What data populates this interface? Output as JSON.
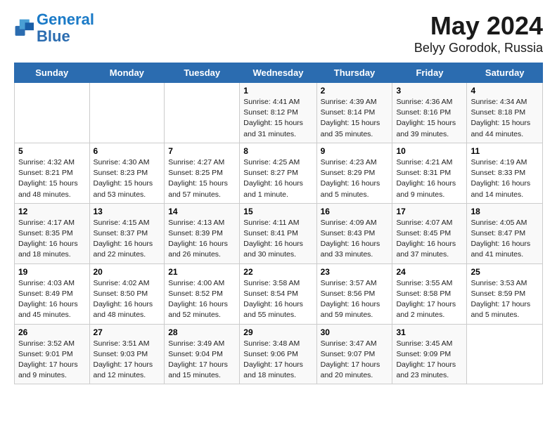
{
  "logo": {
    "line1": "General",
    "line2": "Blue"
  },
  "title": "May 2024",
  "subtitle": "Belyy Gorodok, Russia",
  "days_of_week": [
    "Sunday",
    "Monday",
    "Tuesday",
    "Wednesday",
    "Thursday",
    "Friday",
    "Saturday"
  ],
  "weeks": [
    [
      {
        "day": "",
        "info": ""
      },
      {
        "day": "",
        "info": ""
      },
      {
        "day": "",
        "info": ""
      },
      {
        "day": "1",
        "info": "Sunrise: 4:41 AM\nSunset: 8:12 PM\nDaylight: 15 hours and 31 minutes."
      },
      {
        "day": "2",
        "info": "Sunrise: 4:39 AM\nSunset: 8:14 PM\nDaylight: 15 hours and 35 minutes."
      },
      {
        "day": "3",
        "info": "Sunrise: 4:36 AM\nSunset: 8:16 PM\nDaylight: 15 hours and 39 minutes."
      },
      {
        "day": "4",
        "info": "Sunrise: 4:34 AM\nSunset: 8:18 PM\nDaylight: 15 hours and 44 minutes."
      }
    ],
    [
      {
        "day": "5",
        "info": "Sunrise: 4:32 AM\nSunset: 8:21 PM\nDaylight: 15 hours and 48 minutes."
      },
      {
        "day": "6",
        "info": "Sunrise: 4:30 AM\nSunset: 8:23 PM\nDaylight: 15 hours and 53 minutes."
      },
      {
        "day": "7",
        "info": "Sunrise: 4:27 AM\nSunset: 8:25 PM\nDaylight: 15 hours and 57 minutes."
      },
      {
        "day": "8",
        "info": "Sunrise: 4:25 AM\nSunset: 8:27 PM\nDaylight: 16 hours and 1 minute."
      },
      {
        "day": "9",
        "info": "Sunrise: 4:23 AM\nSunset: 8:29 PM\nDaylight: 16 hours and 5 minutes."
      },
      {
        "day": "10",
        "info": "Sunrise: 4:21 AM\nSunset: 8:31 PM\nDaylight: 16 hours and 9 minutes."
      },
      {
        "day": "11",
        "info": "Sunrise: 4:19 AM\nSunset: 8:33 PM\nDaylight: 16 hours and 14 minutes."
      }
    ],
    [
      {
        "day": "12",
        "info": "Sunrise: 4:17 AM\nSunset: 8:35 PM\nDaylight: 16 hours and 18 minutes."
      },
      {
        "day": "13",
        "info": "Sunrise: 4:15 AM\nSunset: 8:37 PM\nDaylight: 16 hours and 22 minutes."
      },
      {
        "day": "14",
        "info": "Sunrise: 4:13 AM\nSunset: 8:39 PM\nDaylight: 16 hours and 26 minutes."
      },
      {
        "day": "15",
        "info": "Sunrise: 4:11 AM\nSunset: 8:41 PM\nDaylight: 16 hours and 30 minutes."
      },
      {
        "day": "16",
        "info": "Sunrise: 4:09 AM\nSunset: 8:43 PM\nDaylight: 16 hours and 33 minutes."
      },
      {
        "day": "17",
        "info": "Sunrise: 4:07 AM\nSunset: 8:45 PM\nDaylight: 16 hours and 37 minutes."
      },
      {
        "day": "18",
        "info": "Sunrise: 4:05 AM\nSunset: 8:47 PM\nDaylight: 16 hours and 41 minutes."
      }
    ],
    [
      {
        "day": "19",
        "info": "Sunrise: 4:03 AM\nSunset: 8:49 PM\nDaylight: 16 hours and 45 minutes."
      },
      {
        "day": "20",
        "info": "Sunrise: 4:02 AM\nSunset: 8:50 PM\nDaylight: 16 hours and 48 minutes."
      },
      {
        "day": "21",
        "info": "Sunrise: 4:00 AM\nSunset: 8:52 PM\nDaylight: 16 hours and 52 minutes."
      },
      {
        "day": "22",
        "info": "Sunrise: 3:58 AM\nSunset: 8:54 PM\nDaylight: 16 hours and 55 minutes."
      },
      {
        "day": "23",
        "info": "Sunrise: 3:57 AM\nSunset: 8:56 PM\nDaylight: 16 hours and 59 minutes."
      },
      {
        "day": "24",
        "info": "Sunrise: 3:55 AM\nSunset: 8:58 PM\nDaylight: 17 hours and 2 minutes."
      },
      {
        "day": "25",
        "info": "Sunrise: 3:53 AM\nSunset: 8:59 PM\nDaylight: 17 hours and 5 minutes."
      }
    ],
    [
      {
        "day": "26",
        "info": "Sunrise: 3:52 AM\nSunset: 9:01 PM\nDaylight: 17 hours and 9 minutes."
      },
      {
        "day": "27",
        "info": "Sunrise: 3:51 AM\nSunset: 9:03 PM\nDaylight: 17 hours and 12 minutes."
      },
      {
        "day": "28",
        "info": "Sunrise: 3:49 AM\nSunset: 9:04 PM\nDaylight: 17 hours and 15 minutes."
      },
      {
        "day": "29",
        "info": "Sunrise: 3:48 AM\nSunset: 9:06 PM\nDaylight: 17 hours and 18 minutes."
      },
      {
        "day": "30",
        "info": "Sunrise: 3:47 AM\nSunset: 9:07 PM\nDaylight: 17 hours and 20 minutes."
      },
      {
        "day": "31",
        "info": "Sunrise: 3:45 AM\nSunset: 9:09 PM\nDaylight: 17 hours and 23 minutes."
      },
      {
        "day": "",
        "info": ""
      }
    ]
  ]
}
